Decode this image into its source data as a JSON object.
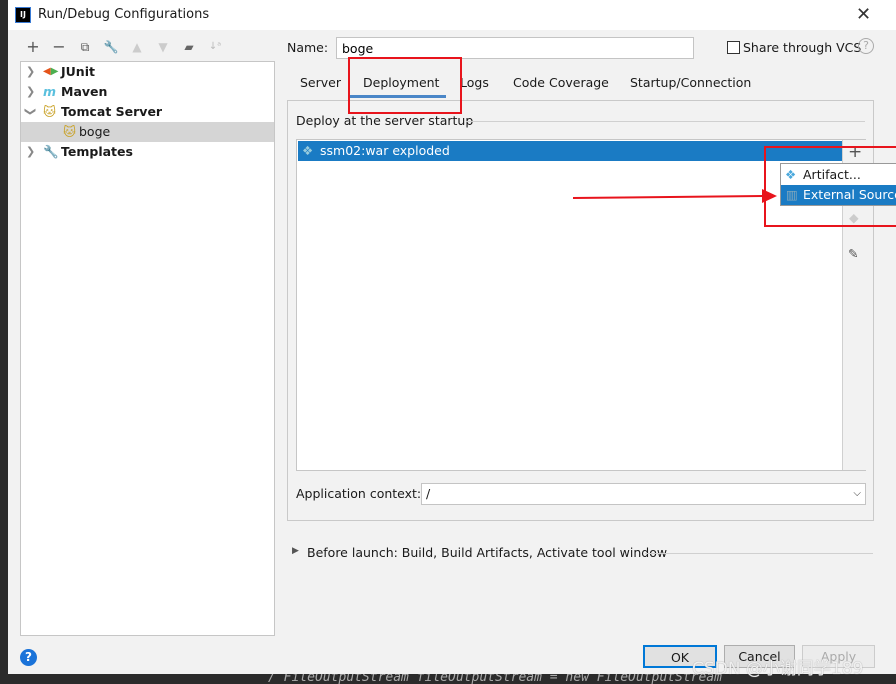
{
  "window": {
    "title": "Run/Debug Configurations",
    "app_icon": "intellij-icon"
  },
  "toolbar": {
    "icons": [
      "plus-icon",
      "minus-icon",
      "copy-icon",
      "wrench-icon",
      "arrow-up-icon",
      "arrow-down-icon",
      "folder-add-icon",
      "sort-az-icon"
    ]
  },
  "tree": {
    "items": [
      {
        "label": "JUnit",
        "icon": "junit-icon",
        "expanded": false
      },
      {
        "label": "Maven",
        "icon": "maven-icon",
        "expanded": false
      },
      {
        "label": "Tomcat Server",
        "icon": "tomcat-icon",
        "expanded": true
      },
      {
        "label": "boge",
        "icon": "tomcat-icon",
        "selected": true
      },
      {
        "label": "Templates",
        "icon": "wrench-icon",
        "expanded": false
      }
    ]
  },
  "name": {
    "label": "Name:",
    "value": "boge"
  },
  "share": {
    "label": "Share through VCS",
    "checked": false
  },
  "tabs": [
    {
      "label": "Server"
    },
    {
      "label": "Deployment",
      "active": true
    },
    {
      "label": "Logs"
    },
    {
      "label": "Code Coverage"
    },
    {
      "label": "Startup/Connection"
    }
  ],
  "deployment": {
    "section_title": "Deploy at the server startup",
    "items": [
      {
        "label": "ssm02:war exploded",
        "selected": true
      }
    ],
    "popup": [
      {
        "label": "Artifact...",
        "icon": "artifact-icon"
      },
      {
        "label": "External Source...",
        "icon": "external-source-icon",
        "highlighted": true
      }
    ],
    "app_context_label": "Application context:",
    "app_context_value": "/"
  },
  "before_launch": "Before launch: Build, Build Artifacts, Activate tool window",
  "buttons": {
    "ok": "OK",
    "cancel": "Cancel",
    "apply": "Apply"
  },
  "watermark": "CSDN @小谢同学189",
  "background_code": "/ FileOutputStream fileOutputStream = new FileOutputStream",
  "colors": {
    "selection": "#1a7bc4",
    "annotation": "#e8141c",
    "tab_underline": "#4a86c7"
  }
}
